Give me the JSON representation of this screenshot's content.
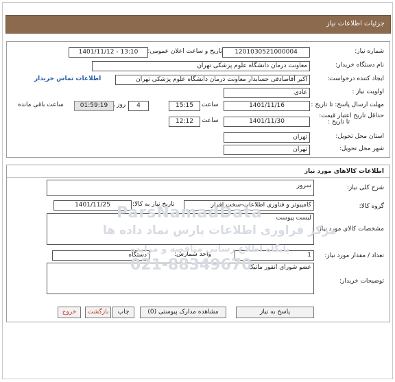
{
  "header": {
    "title": "جزئیات اطلاعات نیاز"
  },
  "request_info": {
    "need_number_label": "شماره نیاز:",
    "need_number": "1201030521000004",
    "announce_label": "تاریخ و ساعت اعلان عمومی:",
    "announce_value": "1401/11/12 - 13:10",
    "buyer_org_label": "نام دستگاه خریدار:",
    "buyer_org": "معاونت درمان دانشگاه علوم پزشکی تهران",
    "requester_label": "ایجاد کننده درخواست:",
    "requester": "اکبر آقاصادقی حسابدار معاونت درمان دانشگاه علوم پزشکی تهران",
    "buyer_contact_link": "اطلاعات تماس خریدار",
    "priority_label": "اولویت نیاز :",
    "priority": "عادی",
    "deadline_label": "مهلت ارسال پاسخ: تا تاریخ :",
    "deadline_date": "1401/11/16",
    "time_label": "ساعت",
    "deadline_time": "15:15",
    "days": "4",
    "days_label": "روز و",
    "remaining_time": "01:59:19",
    "remaining_label": "ساعت باقی مانده",
    "validity_label": "حداقل تاریخ اعتبار قیمت:",
    "validity_to_label": "تا تاریخ :",
    "validity_date": "1401/11/30",
    "validity_time": "12:12",
    "province_label": "استان محل تحویل:",
    "province": "تهران",
    "city_label": "شهر محل تحویل:",
    "city": "تهران"
  },
  "goods_info": {
    "section_title": "اطلاعات کالاهای مورد نیاز",
    "summary_label": "شرح کلی نیاز:",
    "summary": "سرور",
    "group_label": "گروه کالا:",
    "group": "کامپیوتر و فناوری اطلاعات-سخت افزار",
    "need_date_label": "تاریخ نیاز به کالا:",
    "need_date": "1401/11/25",
    "specs_label": "مشخصات کالای مورد نیاز:",
    "specs": "لیست  پیوست",
    "quantity_label": "تعداد / مقدار مورد نیاز:",
    "quantity": "1",
    "unit_label": "واحد شمارش:",
    "unit": "دستگاه",
    "buyer_notes_label": "توضیحات خریدار:",
    "buyer_notes": "عضو شورای انفور ماتیک"
  },
  "buttons": {
    "reply": "پاسخ به نیاز",
    "view_docs": "مشاهده مدارک پیوستی (0)",
    "print": "چاپ",
    "back": "بازگشت",
    "exit": "خروج"
  },
  "watermark": {
    "line1": "ParsNamadData",
    "line2": "مرکز فراوری اطلاعات پارس نماد داده ها",
    "line3": "پایگاه اطلاع رسانی مناقصه و مزایده",
    "line4": "021-88349670"
  }
}
